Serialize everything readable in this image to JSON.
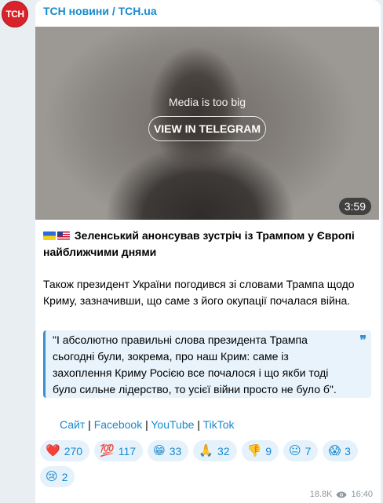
{
  "channel": {
    "avatar_text": "ТСН",
    "name": "ТСН новини / TCH.ua"
  },
  "media": {
    "notice": "Media is too big",
    "button_label": "VIEW IN TELEGRAM",
    "duration": "3:59"
  },
  "post": {
    "headline": "Зеленський анонсував зустріч із Трампом у Європі найближчими днями",
    "paragraph": "Також президент України погодився зі словами Трампа щодо Криму, зазначивши, що саме з його окупації почалася війна.",
    "quote": "\"І абсолютно правильні слова президента Трампа сьогодні були, зокрема, про наш Крим: саме із захоплення Криму Росією все почалося і що якби тоді було сильне лідерство, то усієї війни просто не було б\".",
    "links": [
      {
        "label": "Сайт"
      },
      {
        "label": "Facebook"
      },
      {
        "label": "YouTube"
      },
      {
        "label": "TikTok"
      }
    ],
    "separator": " | "
  },
  "reactions": [
    {
      "emoji": "❤️",
      "icon": "heart-icon",
      "count": "270"
    },
    {
      "emoji": "💯",
      "icon": "hundred-icon",
      "count": "117"
    },
    {
      "emoji": "😁",
      "icon": "grin-icon",
      "count": "33"
    },
    {
      "emoji": "🙏",
      "icon": "pray-icon",
      "count": "32"
    },
    {
      "emoji": "👎",
      "icon": "thumbs-down-icon",
      "count": "9"
    },
    {
      "emoji": "😐",
      "icon": "neutral-face-icon",
      "count": "7"
    },
    {
      "emoji": "😱",
      "icon": "scream-icon",
      "count": "3"
    },
    {
      "emoji": "😢",
      "icon": "cry-icon",
      "count": "2"
    }
  ],
  "meta": {
    "views": "18.8K",
    "time": "16:40"
  },
  "colors": {
    "accent": "#168acd",
    "avatar_bg": "#d8232a",
    "quote_bar": "#3a8fd0"
  }
}
